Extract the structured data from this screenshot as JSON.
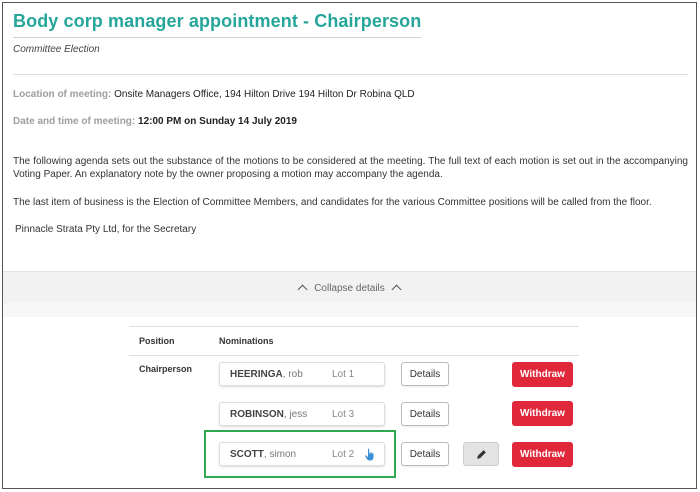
{
  "header": {
    "title": "Body corp manager appointment - Chairperson",
    "subtitle": "Committee Election"
  },
  "meeting": {
    "location_label": "Location of meeting:",
    "location_value": "Onsite Managers Office, 194 Hilton Drive 194 Hilton Dr Robina QLD",
    "datetime_label": "Date and time of meeting:",
    "datetime_value": "12:00 PM on Sunday 14 July 2019"
  },
  "body": {
    "para1": "The following agenda sets out the substance of the motions to be considered at the meeting.  The full text of each motion is set out in the accompanying Voting Paper.  An explanatory note by the owner proposing a motion may accompany the agenda.",
    "para2": "The last item of business is the Election of Committee Members, and candidates for the various Committee positions will be called from the floor.",
    "signature": "Pinnacle Strata Pty Ltd, for the Secretary"
  },
  "collapse": {
    "label": "Collapse details"
  },
  "table": {
    "col_position": "Position",
    "col_nominations": "Nominations",
    "position": "Chairperson",
    "nominations": [
      {
        "surname": "HEERINGA",
        "given": ", rob",
        "lot": "Lot 1"
      },
      {
        "surname": "ROBINSON",
        "given": ", jess",
        "lot": "Lot 3"
      },
      {
        "surname": "SCOTT",
        "given": ", simon",
        "lot": "Lot 2"
      }
    ],
    "details_label": "Details",
    "withdraw_label": "Withdraw"
  },
  "colors": {
    "title": "#26a69a",
    "withdraw": "#e0283a",
    "highlight": "#2ea84a",
    "hand_icon": "#3a8fd8"
  },
  "icons": [
    "chevron-up-icon",
    "hand-pointer-icon",
    "pencil-icon"
  ]
}
